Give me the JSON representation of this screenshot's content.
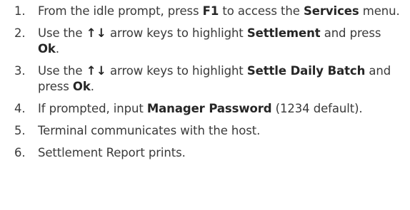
{
  "steps": [
    {
      "number": "1.",
      "parts": [
        {
          "text": "From the idle prompt, press ",
          "bold": false
        },
        {
          "text": "F1",
          "bold": true
        },
        {
          "text": " to access the ",
          "bold": false
        },
        {
          "text": "Services",
          "bold": true
        },
        {
          "text": " menu.",
          "bold": false
        }
      ]
    },
    {
      "number": "2.",
      "parts": [
        {
          "text": "Use the ",
          "bold": false
        },
        {
          "text": "↑↓",
          "bold": true,
          "arrows": true
        },
        {
          "text": " arrow keys to highlight ",
          "bold": false
        },
        {
          "text": "Settlement",
          "bold": true
        },
        {
          "text": " and press ",
          "bold": false
        },
        {
          "text": "Ok",
          "bold": true
        },
        {
          "text": ".",
          "bold": false
        }
      ]
    },
    {
      "number": "3.",
      "parts": [
        {
          "text": "Use the ",
          "bold": false
        },
        {
          "text": "↑↓",
          "bold": true,
          "arrows": true
        },
        {
          "text": " arrow keys to highlight ",
          "bold": false
        },
        {
          "text": "Settle Daily Batch",
          "bold": true
        },
        {
          "text": " and press ",
          "bold": false
        },
        {
          "text": "Ok",
          "bold": true
        },
        {
          "text": ".",
          "bold": false
        }
      ]
    },
    {
      "number": "4.",
      "parts": [
        {
          "text": "If prompted, input ",
          "bold": false
        },
        {
          "text": "Manager Password",
          "bold": true
        },
        {
          "text": " (1234 default).",
          "bold": false
        }
      ]
    },
    {
      "number": "5.",
      "parts": [
        {
          "text": "Terminal communicates with the host.",
          "bold": false
        }
      ]
    },
    {
      "number": "6.",
      "parts": [
        {
          "text": "Settlement Report prints.",
          "bold": false
        }
      ]
    }
  ]
}
